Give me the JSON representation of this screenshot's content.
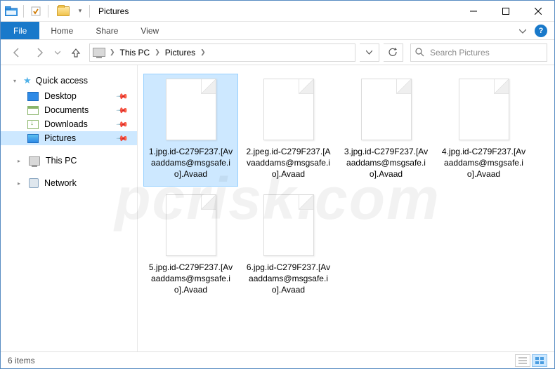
{
  "window": {
    "title": "Pictures"
  },
  "ribbon": {
    "file": "File",
    "tabs": [
      "Home",
      "Share",
      "View"
    ]
  },
  "breadcrumb": {
    "root": "This PC",
    "folder": "Pictures"
  },
  "search": {
    "placeholder": "Search Pictures"
  },
  "sidebar": {
    "quick_access": "Quick access",
    "items": [
      {
        "label": "Desktop"
      },
      {
        "label": "Documents"
      },
      {
        "label": "Downloads"
      },
      {
        "label": "Pictures"
      }
    ],
    "this_pc": "This PC",
    "network": "Network"
  },
  "files": [
    {
      "name": "1.jpg.id-C279F237.[Avaaddams@msgsafe.io].Avaad"
    },
    {
      "name": "2.jpeg.id-C279F237.[Avaaddams@msgsafe.io].Avaad"
    },
    {
      "name": "3.jpg.id-C279F237.[Avaaddams@msgsafe.io].Avaad"
    },
    {
      "name": "4.jpg.id-C279F237.[Avaaddams@msgsafe.io].Avaad"
    },
    {
      "name": "5.jpg.id-C279F237.[Avaaddams@msgsafe.io].Avaad"
    },
    {
      "name": "6.jpg.id-C279F237.[Avaaddams@msgsafe.io].Avaad"
    }
  ],
  "status": {
    "count": "6 items"
  },
  "watermark": "pcrisk.com"
}
